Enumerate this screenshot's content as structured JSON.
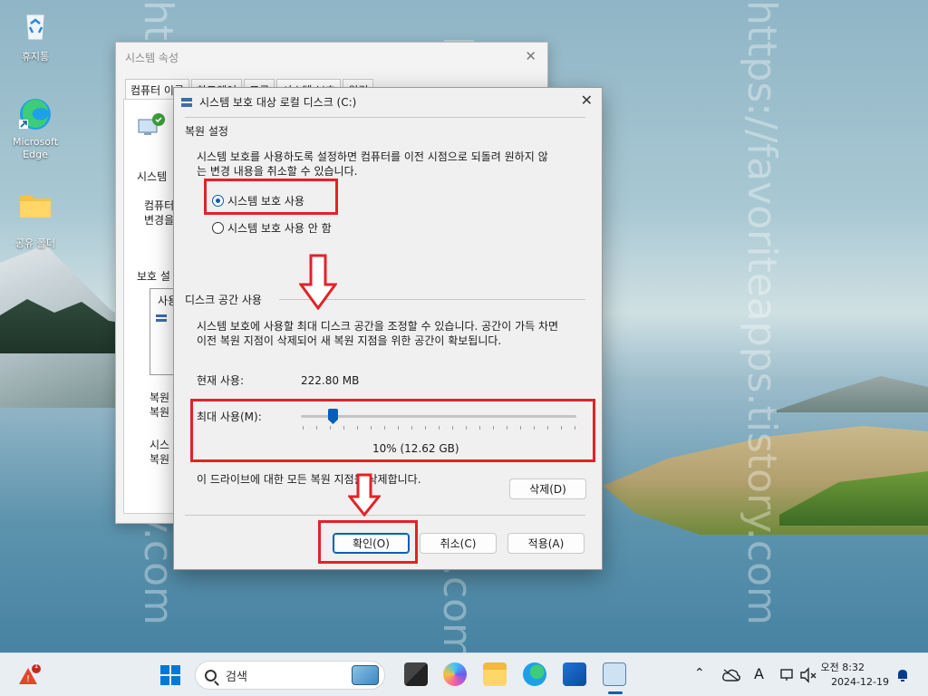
{
  "desktop": {
    "icons": [
      {
        "label": "휴지통"
      },
      {
        "label": "Microsoft Edge"
      },
      {
        "label": "공유 폴더"
      }
    ],
    "watermark": "https://favoriteapps.tistory.com"
  },
  "back_window": {
    "title": "시스템 속성",
    "tabs": [
      "컴퓨터 이름",
      "하드웨어",
      "고급",
      "시스템 보호",
      "원격"
    ],
    "texts": [
      "시스템",
      "컴퓨터",
      "변경을",
      "보호 설",
      "사용",
      "복원",
      "복원",
      "시스",
      "복원"
    ]
  },
  "dialog": {
    "title": "시스템 보호 대상 로컬 디스크 (C:)",
    "restore_section": "복원 설정",
    "restore_desc_1": "시스템 보호를 사용하도록 설정하면 컴퓨터를 이전 시점으로 되돌려 원하지 않",
    "restore_desc_2": "는 변경 내용을 취소할 수 있습니다.",
    "radio_on": "시스템 보호 사용",
    "radio_off": "시스템 보호 사용 안 함",
    "disk_section": "디스크 공간 사용",
    "disk_desc_1": "시스템 보호에 사용할 최대 디스크 공간을 조정할 수 있습니다. 공간이 가득 차면",
    "disk_desc_2": "이전 복원 지점이 삭제되어 새 복원 지점을 위한 공간이 확보됩니다.",
    "current_label": "현재 사용:",
    "current_value": "222.80 MB",
    "max_label": "최대 사용(M):",
    "max_value": "10% (12.62 GB)",
    "max_fraction": 0.1,
    "delete_desc": "이 드라이브에 대한 모든 복원 지점을 삭제합니다.",
    "delete_btn": "삭제(D)",
    "ok_btn": "확인(O)",
    "cancel_btn": "취소(C)",
    "apply_btn": "적용(A)"
  },
  "taskbar": {
    "search_placeholder": "검색",
    "clock_time": "오전 8:32",
    "clock_date": "2024-12-19",
    "ime": "A",
    "notification_badge": "1"
  },
  "colors": {
    "accent": "#005fb8",
    "annotation": "#e32227"
  }
}
